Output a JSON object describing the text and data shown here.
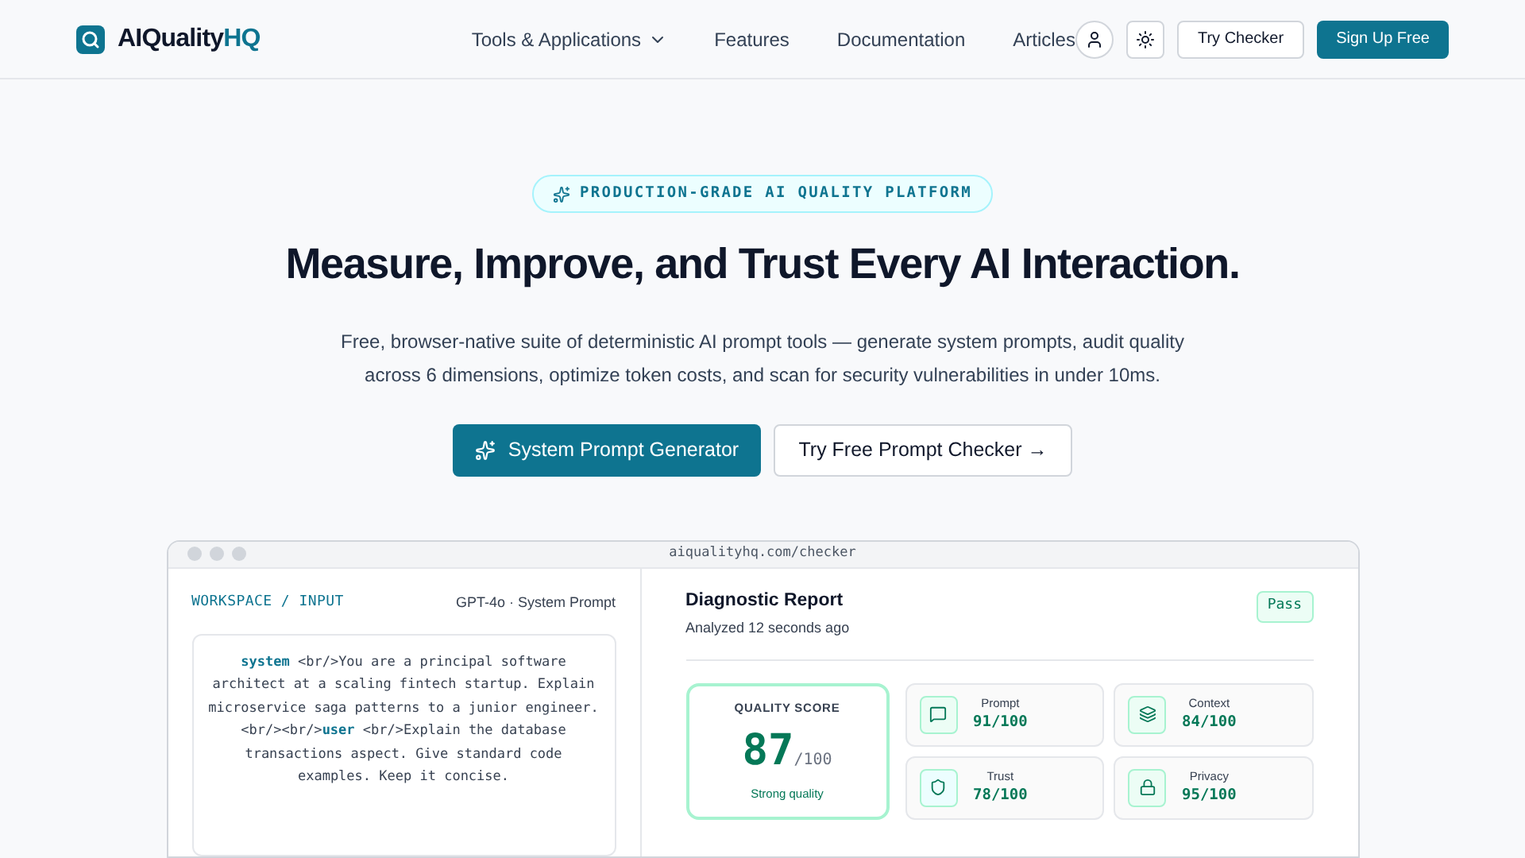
{
  "brand": {
    "name": "AIQuality",
    "accent": "HQ"
  },
  "nav": [
    {
      "label": "Tools & Applications",
      "dropdown": true
    },
    {
      "label": "Features",
      "dropdown": false
    },
    {
      "label": "Documentation",
      "dropdown": false
    },
    {
      "label": "Articles",
      "dropdown": false
    }
  ],
  "header_buttons": {
    "secondary": "Try Checker",
    "primary": "Sign Up Free"
  },
  "hero": {
    "badge": "PRODUCTION-GRADE AI QUALITY PLATFORM",
    "title": "Measure, Improve, and Trust Every AI Interaction.",
    "subtitle": "Free, browser-native suite of deterministic AI prompt tools — generate system prompts, audit quality across 6 dimensions, optimize token costs, and scan for security vulnerabilities in under 10ms.",
    "primary_button": "System Prompt Generator",
    "secondary_button": "Try Free Prompt Checker →"
  },
  "preview": {
    "url": "aiqualityhq.com/checker",
    "workspace": {
      "label": "WORKSPACE / INPUT",
      "model": "GPT-4o · System Prompt",
      "prompt": [
        {
          "kind": "role",
          "text": "system"
        },
        {
          "kind": "text",
          "text": " <br/>You are a principal software architect at a scaling fintech startup. Explain microservice saga patterns to a junior engineer.<br/><br/>"
        },
        {
          "kind": "role",
          "text": "user"
        },
        {
          "kind": "text",
          "text": " <br/>Explain the database transactions aspect. Give standard code examples. Keep it concise."
        }
      ]
    },
    "report": {
      "title": "Diagnostic Report",
      "subtitle": "Analyzed 12 seconds ago",
      "status": "Pass",
      "score_label": "QUALITY SCORE",
      "score": "87",
      "score_max": "/100",
      "score_note": "Strong quality",
      "metrics": [
        {
          "kind": "message",
          "label": "Prompt",
          "value": "91/100",
          "color": "#ecfdf5"
        },
        {
          "kind": "layers",
          "label": "Context",
          "value": "84/100",
          "color": "#ecfdf5"
        },
        {
          "kind": "shield",
          "label": "Trust",
          "value": "78/100",
          "color": "#ecfeff"
        },
        {
          "kind": "lock",
          "label": "Privacy",
          "value": "95/100",
          "color": "#ecfdf5"
        }
      ]
    }
  }
}
